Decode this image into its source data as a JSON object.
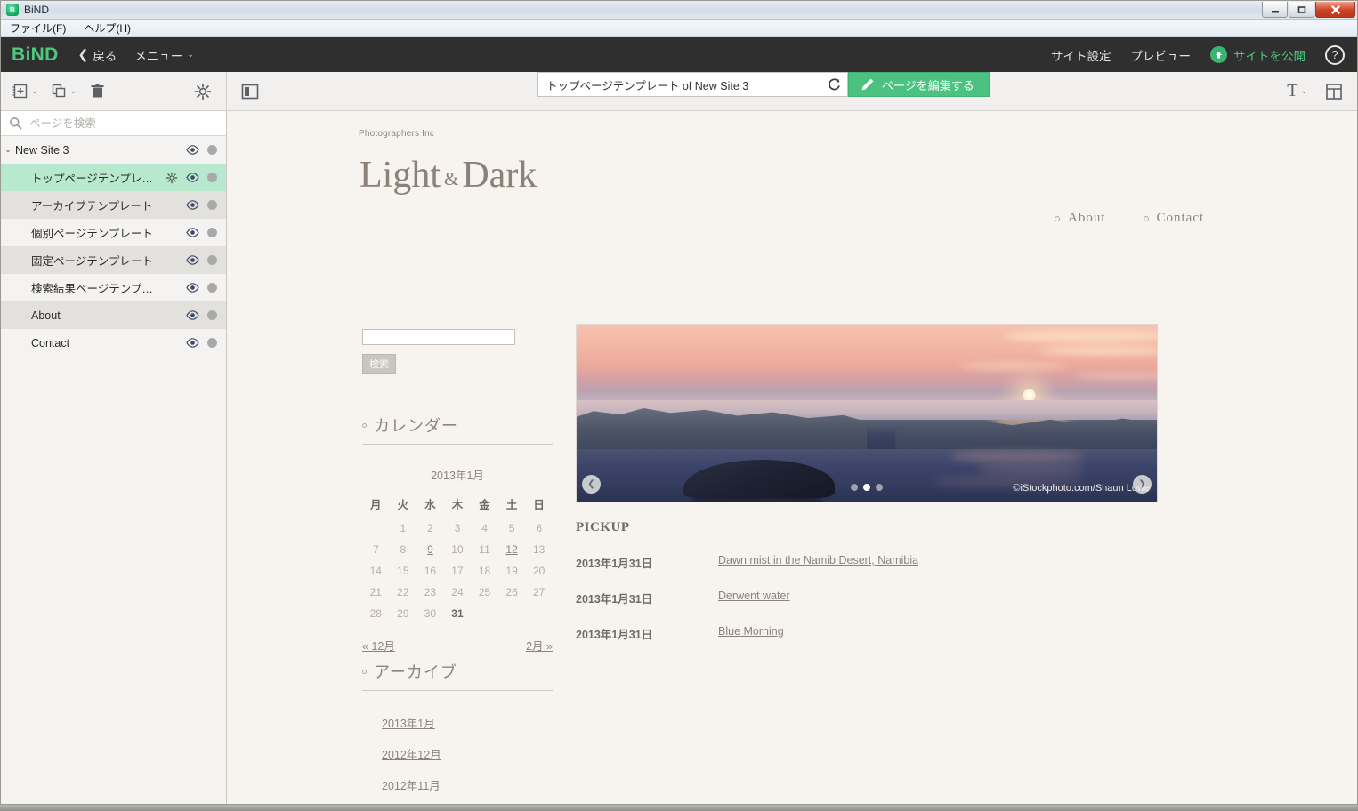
{
  "window": {
    "title": "BiND",
    "controls": {
      "minimize": "—",
      "maximize": "❐",
      "close": "✕"
    }
  },
  "menubar": {
    "items": [
      "ファイル(F)",
      "ヘルプ(H)"
    ]
  },
  "appheader": {
    "brand": "BiND",
    "back": "戻る",
    "menu": "メニュー",
    "site_settings": "サイト設定",
    "preview": "プレビュー",
    "publish": "サイトを公開",
    "help": "?"
  },
  "toolbar": {
    "url_value": "トップページテンプレート of New Site 3",
    "edit_page": "ページを編集する"
  },
  "sidebar": {
    "search_placeholder": "ページを検索",
    "tree": [
      {
        "label": "New Site 3",
        "level": 0,
        "selected": false,
        "gear": false
      },
      {
        "label": "トップページテンプレ…",
        "level": 1,
        "selected": true,
        "gear": true
      },
      {
        "label": "アーカイブテンプレート",
        "level": 1,
        "selected": false,
        "gear": false
      },
      {
        "label": "個別ページテンプレート",
        "level": 1,
        "selected": false,
        "gear": false
      },
      {
        "label": "固定ページテンプレート",
        "level": 1,
        "selected": false,
        "gear": false
      },
      {
        "label": "検索結果ページテンプ…",
        "level": 1,
        "selected": false,
        "gear": false
      },
      {
        "label": "About",
        "level": 1,
        "selected": false,
        "gear": false
      },
      {
        "label": "Contact",
        "level": 1,
        "selected": false,
        "gear": false
      }
    ]
  },
  "site": {
    "brandline": "Photographers Inc",
    "title_part1": "Light",
    "title_amp": "&",
    "title_part2": "Dark",
    "nav": [
      "About",
      "Contact"
    ],
    "search_button": "検索",
    "calendar": {
      "heading": "カレンダー",
      "month_label": "2013年1月",
      "weekdays": [
        "月",
        "火",
        "水",
        "木",
        "金",
        "土",
        "日"
      ],
      "weeks": [
        [
          {
            "d": ""
          },
          {
            "d": "1"
          },
          {
            "d": "2"
          },
          {
            "d": "3"
          },
          {
            "d": "4"
          },
          {
            "d": "5"
          },
          {
            "d": "6"
          }
        ],
        [
          {
            "d": "7"
          },
          {
            "d": "8"
          },
          {
            "d": "9",
            "link": true
          },
          {
            "d": "10"
          },
          {
            "d": "11"
          },
          {
            "d": "12",
            "link": true
          },
          {
            "d": "13"
          }
        ],
        [
          {
            "d": "14"
          },
          {
            "d": "15"
          },
          {
            "d": "16"
          },
          {
            "d": "17"
          },
          {
            "d": "18"
          },
          {
            "d": "19"
          },
          {
            "d": "20"
          }
        ],
        [
          {
            "d": "21"
          },
          {
            "d": "22"
          },
          {
            "d": "23"
          },
          {
            "d": "24"
          },
          {
            "d": "25"
          },
          {
            "d": "26"
          },
          {
            "d": "27"
          }
        ],
        [
          {
            "d": "28"
          },
          {
            "d": "29"
          },
          {
            "d": "30"
          },
          {
            "d": "31",
            "bold": true
          },
          {
            "d": ""
          },
          {
            "d": ""
          },
          {
            "d": ""
          }
        ]
      ],
      "prev": "« 12月",
      "next": "2月 »"
    },
    "archive": {
      "heading": "アーカイブ",
      "items": [
        "2013年1月",
        "2012年12月",
        "2012年11月"
      ]
    },
    "carousel": {
      "credit": "©iStockphoto.com/Shaun Lowe",
      "dots": 3,
      "active_dot": 1,
      "prev": "❮",
      "next": "❯"
    },
    "pickup": {
      "heading": "PICKUP",
      "rows": [
        {
          "date": "2013年1月31日",
          "title": "Dawn mist in the Namib Desert, Namibia"
        },
        {
          "date": "2013年1月31日",
          "title": "Derwent water"
        },
        {
          "date": "2013年1月31日",
          "title": "Blue Morning"
        }
      ]
    }
  },
  "colors": {
    "brand_green": "#4cc97f",
    "header_dark": "#2f2f2f",
    "selection_green": "#b8e8cd",
    "page_bg": "#f7f4ef"
  }
}
